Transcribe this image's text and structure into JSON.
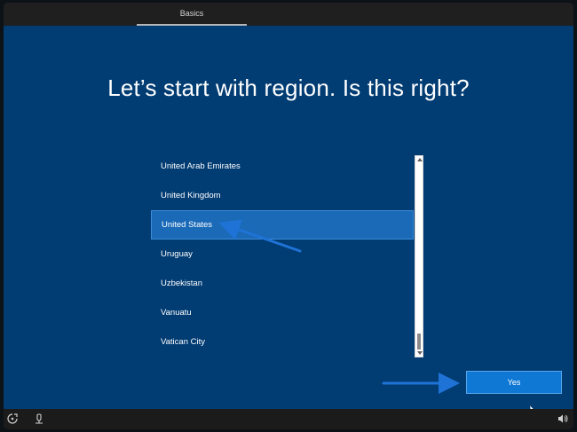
{
  "header": {
    "tab_label": "Basics"
  },
  "main": {
    "title": "Let’s start with region. Is this right?",
    "regions": [
      {
        "label": "United Arab Emirates",
        "selected": false
      },
      {
        "label": "United Kingdom",
        "selected": false
      },
      {
        "label": "United States",
        "selected": true
      },
      {
        "label": "Uruguay",
        "selected": false
      },
      {
        "label": "Uzbekistan",
        "selected": false
      },
      {
        "label": "Vanuatu",
        "selected": false
      },
      {
        "label": "Vatican City",
        "selected": false
      }
    ],
    "yes_label": "Yes"
  },
  "footer": {
    "icons": [
      "ease-of-access-icon",
      "narrator-icon",
      "volume-icon"
    ]
  },
  "colors": {
    "background": "#013c73",
    "selected": "#1a6ab8",
    "button": "#0f77d4",
    "annotation_arrow": "#1f73d6"
  }
}
